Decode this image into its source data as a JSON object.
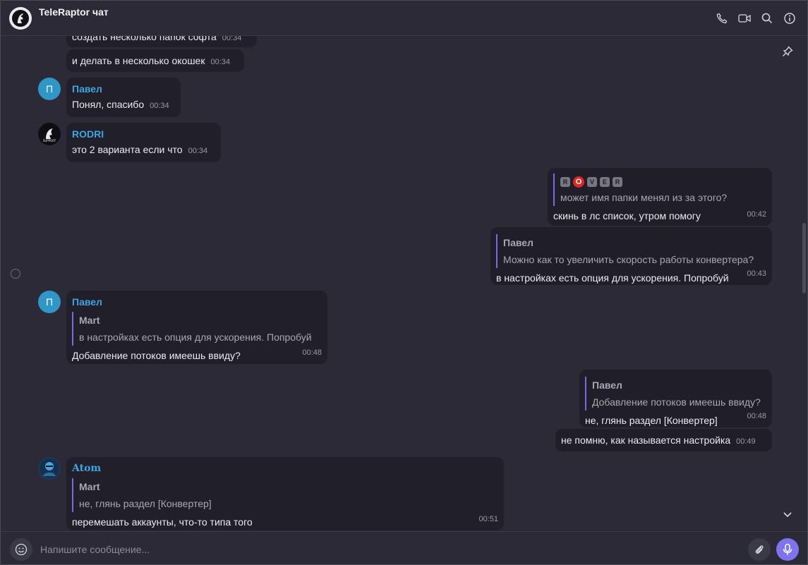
{
  "app": {
    "title": "TeleRaptor чат",
    "accent": "#7f73f0",
    "sender_color": "#3da6e0"
  },
  "header_icons": [
    "phone-icon",
    "video-icon",
    "search-icon",
    "info-icon"
  ],
  "messages": [
    {
      "text": "создать несколько папок софта",
      "time": "00:34"
    },
    {
      "text": "и делать в несколько окошек",
      "time": "00:34"
    },
    {
      "sender": "Павел",
      "avatar_letter": "П",
      "text": "Понял, спасибо",
      "time": "00:34"
    },
    {
      "sender": "RODRI",
      "text": "это 2 варианта если что",
      "time": "00:34"
    },
    {
      "out": true,
      "quote_badges": [
        "R",
        "O",
        "V",
        "E",
        "R"
      ],
      "quote_text": "может имя папки менял из за этого?",
      "text": "скинь в лс список, утром помогу",
      "time": "00:42"
    },
    {
      "out": true,
      "quote_name": "Павел",
      "quote_text": "Можно как то увеличить скорость работы конвертера?",
      "text": "в настройках есть опция для ускорения. Попробуй",
      "time": "00:43"
    },
    {
      "sender": "Павел",
      "avatar_letter": "П",
      "quote_name": "Mart",
      "quote_text": "в настройках есть опция для ускорения. Попробуй",
      "text": "Добавление потоков имеешь ввиду?",
      "time": "00:48"
    },
    {
      "out": true,
      "quote_name": "Павел",
      "quote_text": "Добавление потоков имеешь ввиду?",
      "text": "не, глянь раздел [Конвертер]",
      "time": "00:48"
    },
    {
      "out": true,
      "text": "не помню, как называется настройка",
      "time": "00:49"
    },
    {
      "sender": "Atom",
      "quote_name": "Mart",
      "quote_text": "не, глянь раздел [Конвертер]",
      "text": "перемешать аккаунты, что-то типа того",
      "time": "00:51"
    }
  ],
  "composer": {
    "placeholder": "Напишите сообщение..."
  }
}
